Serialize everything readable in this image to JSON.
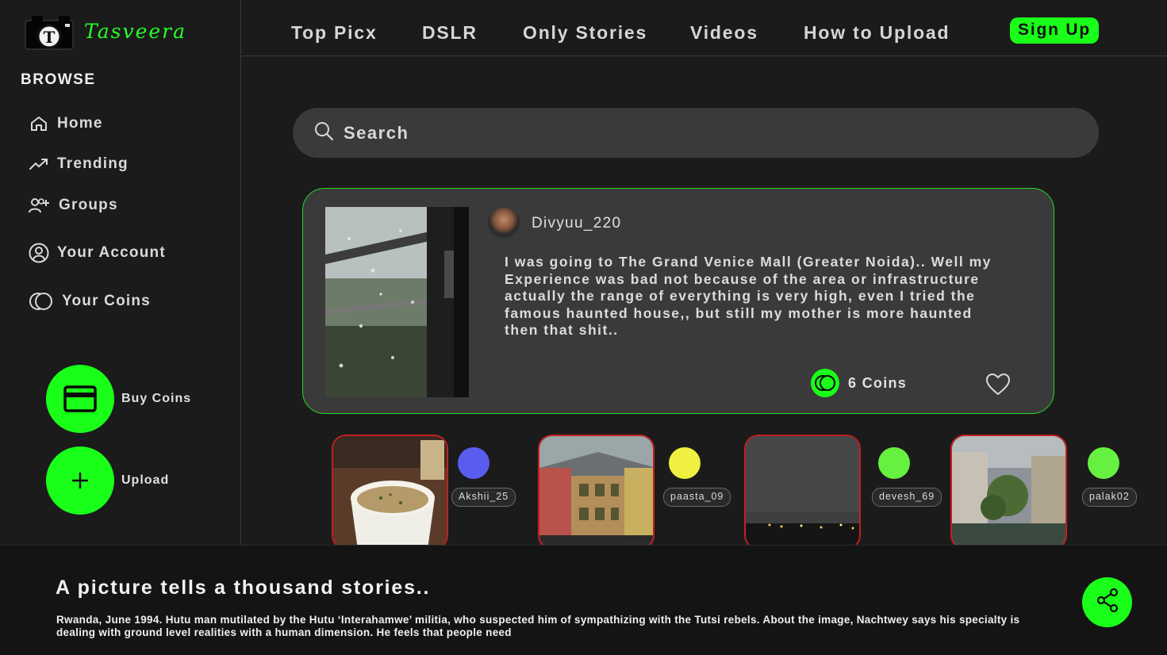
{
  "app": {
    "brand": "Tasveera",
    "logo_letter": "T"
  },
  "nav_tabs": [
    "Top Picx",
    "DSLR",
    "Only Stories",
    "Videos",
    "How to Upload"
  ],
  "signup_label": "Sign Up",
  "sidebar": {
    "heading": "BROWSE",
    "items": [
      {
        "label": "Home",
        "icon": "home-icon"
      },
      {
        "label": "Trending",
        "icon": "trending-icon"
      },
      {
        "label": "Groups",
        "icon": "add-group-icon"
      },
      {
        "label": "Your Account",
        "icon": "account-icon"
      },
      {
        "label": "Your Coins",
        "icon": "coins-icon"
      }
    ],
    "actions": [
      {
        "label": "Buy Coins",
        "icon": "credit-card-icon"
      },
      {
        "label": "Upload",
        "icon": "plus-icon"
      }
    ]
  },
  "search": {
    "placeholder": "Search"
  },
  "featured_post": {
    "username": "Divyuu_220",
    "text": "I was going to The Grand Venice Mall (Greater Noida).. Well my Experience was bad not because of the area or infrastructure actually the range of everything  is very high, even I tried the famous haunted house,, but still my mother is more haunted then that shit..",
    "coins_label": "6 Coins"
  },
  "stories": [
    {
      "username": "Akshii_25",
      "dot_color": "#5a5cf0"
    },
    {
      "username": "paasta_09",
      "dot_color": "#f0f040"
    },
    {
      "username": "devesh_69",
      "dot_color": "#66f040"
    },
    {
      "username": "palak02",
      "dot_color": "#66f040"
    }
  ],
  "footer": {
    "title": "A picture tells a thousand stories..",
    "body": "Rwanda, June 1994. Hutu man mutilated by the Hutu ‘Interahamwe’ militia, who suspected him of sympathizing with the Tutsi rebels. About the image, Nachtwey says his specialty is dealing with ground level realities with a human dimension. He feels that people need"
  },
  "colors": {
    "accent": "#1aff1a",
    "card_border": "#27d827",
    "thumb_border": "#c32020",
    "card_bg": "#3a3a3a",
    "bg": "#1b1b1b"
  }
}
